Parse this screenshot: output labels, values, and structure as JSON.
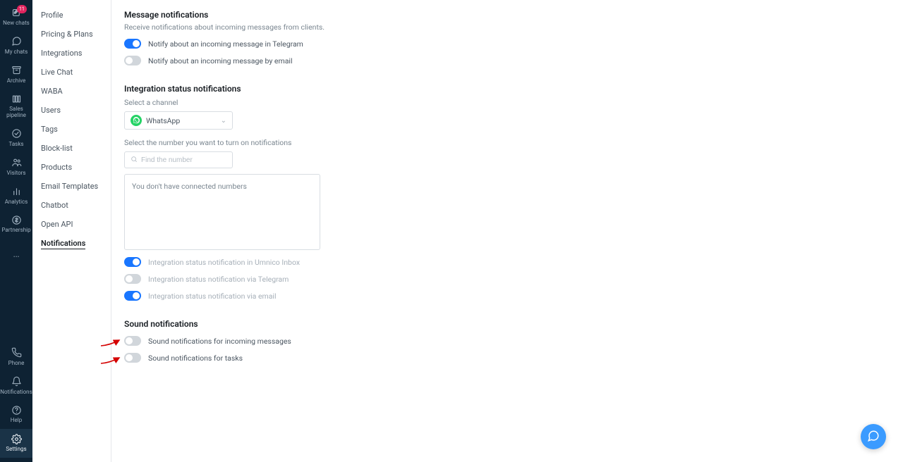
{
  "rail": {
    "top": [
      {
        "key": "new-chats",
        "label": "New chats",
        "icon": "edit",
        "badge": "11"
      },
      {
        "key": "my-chats",
        "label": "My chats",
        "icon": "chat"
      },
      {
        "key": "archive",
        "label": "Archive",
        "icon": "archive"
      },
      {
        "key": "sales",
        "label": "Sales\npipeline",
        "icon": "columns"
      },
      {
        "key": "tasks",
        "label": "Tasks",
        "icon": "check"
      },
      {
        "key": "visitors",
        "label": "Visitors",
        "icon": "users"
      },
      {
        "key": "analytics",
        "label": "Analytics",
        "icon": "bars"
      },
      {
        "key": "partnership",
        "label": "Partnership",
        "icon": "dollar"
      }
    ],
    "ellipsis": "…",
    "bottom": [
      {
        "key": "phone",
        "label": "Phone",
        "icon": "phone"
      },
      {
        "key": "notifications",
        "label": "Notifications",
        "icon": "bell"
      },
      {
        "key": "help",
        "label": "Help",
        "icon": "helpq"
      },
      {
        "key": "settings",
        "label": "Settings",
        "icon": "gear",
        "active": true
      }
    ]
  },
  "subnav": {
    "items": [
      "Profile",
      "Pricing & Plans",
      "Integrations",
      "Live Chat",
      "WABA",
      "Users",
      "Tags",
      "Block-list",
      "Products",
      "Email Templates",
      "Chatbot",
      "Open API",
      "Notifications"
    ],
    "activeIndex": 12
  },
  "content": {
    "message": {
      "title": "Message notifications",
      "sub": "Receive notifications about incoming messages from clients.",
      "toggle_telegram": {
        "on": true,
        "label": "Notify about an incoming message in Telegram"
      },
      "toggle_email": {
        "on": false,
        "label": "Notify about an incoming message by email"
      }
    },
    "integration": {
      "title": "Integration status notifications",
      "channel_label": "Select a channel",
      "channel_value": "WhatsApp",
      "number_label": "Select the number you want to turn on notifications",
      "number_placeholder": "Find the number",
      "numbers_empty": "You don't have connected numbers",
      "toggle_inbox": {
        "on": true,
        "label": "Integration status notification in Umnico Inbox"
      },
      "toggle_telegram": {
        "on": false,
        "label": "Integration status notification via Telegram"
      },
      "toggle_email": {
        "on": true,
        "label": "Integration status notification via email"
      }
    },
    "sound": {
      "title": "Sound notifications",
      "toggle_messages": {
        "on": false,
        "label": "Sound notifications for incoming messages"
      },
      "toggle_tasks": {
        "on": false,
        "label": "Sound notifications for tasks"
      }
    }
  }
}
